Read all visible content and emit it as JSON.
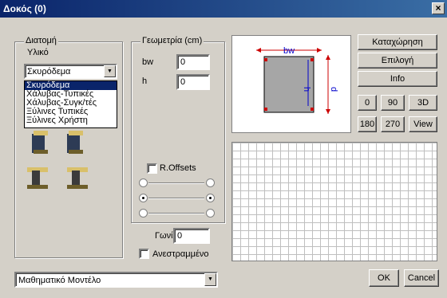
{
  "window": {
    "title": "Δοκός (0)",
    "close_glyph": "×"
  },
  "section": {
    "label": "Διατομή",
    "material_label": "Υλικό",
    "material_value": "Σκυρόδεμα",
    "material_options": [
      "Σκυρόδεμα",
      "Χάλυβας-Τυπικές",
      "Χάλυβας-Συγκ/τές",
      "Ξύλινες Τυπικές",
      "Ξύλινες Χρήστη"
    ],
    "selected_option_index": 0
  },
  "geometry": {
    "label": "Γεωμετρία (cm)",
    "bw_label": "bw",
    "bw_value": "0",
    "h_label": "h",
    "h_value": "0",
    "roffsets_label": "R.Offsets",
    "angle_label": "Γωνία",
    "angle_value": "0",
    "inverted_label": "Ανεστραμμένο"
  },
  "preview": {
    "bw_label": "bw",
    "d_label": "d",
    "h_label": "h"
  },
  "buttons": {
    "register": "Καταχώρηση",
    "select": "Επιλογή",
    "info": "Info",
    "view_0": "0",
    "view_90": "90",
    "view_3d": "3D",
    "view_180": "180",
    "view_270": "270",
    "view": "View",
    "ok": "OK",
    "cancel": "Cancel"
  },
  "model": {
    "value": "Μαθηματικό Μοντέλο"
  }
}
